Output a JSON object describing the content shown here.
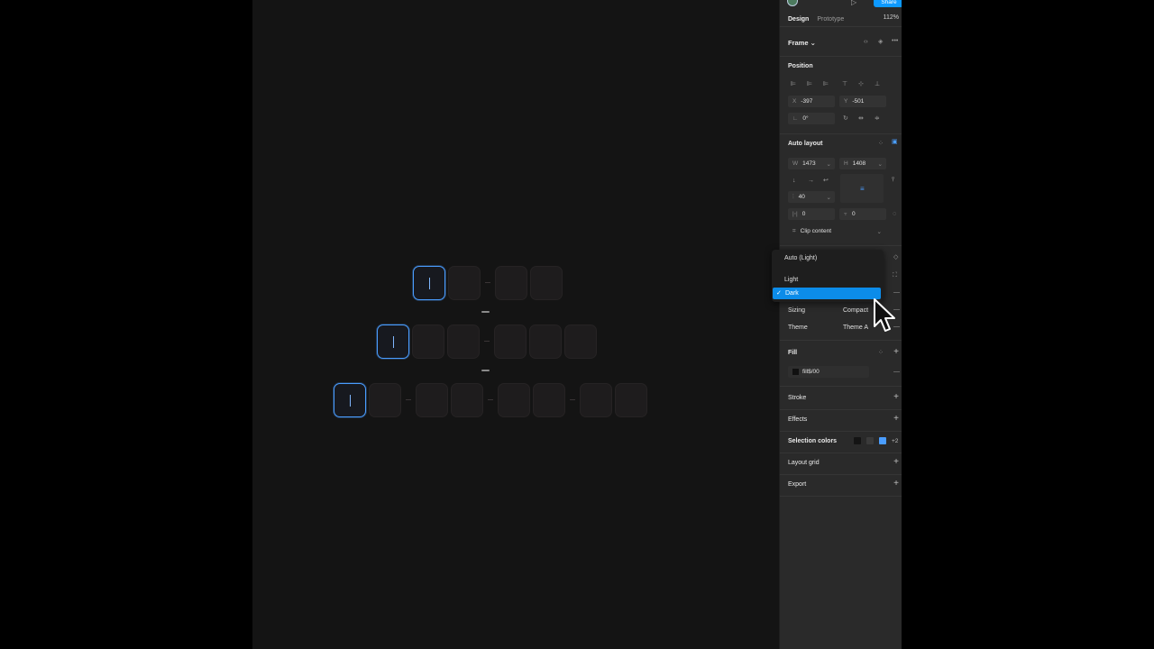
{
  "topbar": {
    "share_label": "Share"
  },
  "tabs": {
    "design": "Design",
    "prototype": "Prototype",
    "zoom": "112%"
  },
  "frame": {
    "label": "Frame ⌄"
  },
  "position": {
    "title": "Position",
    "x_key": "X",
    "x": "-397",
    "y_key": "Y",
    "y": "-501",
    "rotation": "0°"
  },
  "auto_layout": {
    "title": "Auto layout",
    "w_key": "W",
    "w": "1473",
    "h_key": "H",
    "h": "1408",
    "gap": "40",
    "pad_h": "0",
    "pad_v": "0",
    "clip": "Clip content"
  },
  "dropdown": {
    "items": [
      "Auto (Light)",
      "Light",
      "Dark"
    ],
    "selected": "Dark"
  },
  "props": {
    "sizing_label": "Sizing",
    "sizing_value": "Compact",
    "theme_label": "Theme",
    "theme_value": "Theme A"
  },
  "fill": {
    "title": "Fill",
    "value": "fill$/00"
  },
  "sections": {
    "stroke": "Stroke",
    "effects": "Effects",
    "selection_colors": "Selection colors",
    "selection_more": "+2",
    "layout_grid": "Layout grid",
    "export": "Export"
  },
  "colors": {
    "accent": "#0d99ff",
    "selected": "#0c8ce9",
    "panel": "#2a2a2a",
    "canvas": "#141414",
    "focus": "#4a9dff"
  }
}
